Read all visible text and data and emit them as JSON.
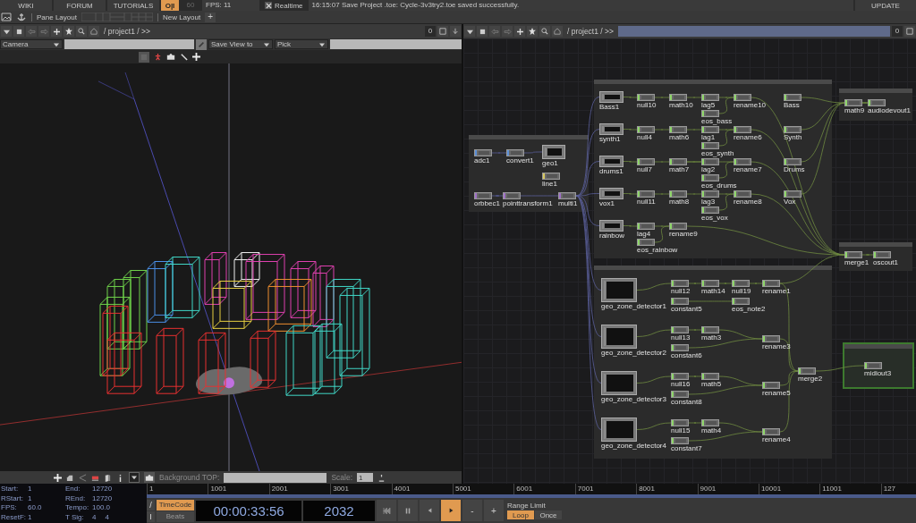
{
  "top_bar": {
    "links": [
      "WIKI",
      "FORUM",
      "TUTORIALS"
    ],
    "perform_toggle": {
      "label": "O|I",
      "on": true
    },
    "fps_limit": "60",
    "fps": "FPS:  11",
    "realtime": {
      "label": "Realtime",
      "checked": true
    },
    "message": "16:15:07 Save Project .toe: Cycle-3v3try2.toe saved successfully.",
    "update": "UPDATE"
  },
  "layout_bar": {
    "pane_layout": "Pane Layout",
    "new_layout": "New Layout",
    "add": "+"
  },
  "viewer_pane": {
    "path": "/ project1 / >>",
    "badge": "0",
    "camera": "Camera",
    "save_view": "Save View to",
    "pick": "Pick",
    "background_label": "Background TOP:",
    "scale_label": "Scale:",
    "scale": "1"
  },
  "network_pane": {
    "path": "/ project1 / >>",
    "badge": "0",
    "groups": [
      {
        "nodes": [
          {
            "name": "adc1",
            "kind": "op",
            "color": "#5b8fd6"
          },
          {
            "name": "convert1",
            "kind": "op",
            "color": "#5b8fd6"
          },
          {
            "name": "geo1",
            "kind": "preview",
            "color": "#8a8a8a"
          },
          {
            "name": "line1",
            "kind": "op",
            "color": "#d8c860"
          },
          {
            "name": "orbbec1",
            "kind": "op",
            "color": "#a070c8"
          },
          {
            "name": "pointtransform1",
            "kind": "op",
            "color": "#a070c8"
          },
          {
            "name": "multi1",
            "kind": "op",
            "color": "#a070c8"
          }
        ]
      },
      {
        "nodes": [
          {
            "name": "Bass1",
            "kind": "preview",
            "color": "#8a8a8a"
          },
          {
            "name": "null10",
            "kind": "op",
            "color": "#8fd66a"
          },
          {
            "name": "math10",
            "kind": "op",
            "color": "#8fd66a"
          },
          {
            "name": "lag5",
            "kind": "op",
            "color": "#8fd66a"
          },
          {
            "name": "rename10",
            "kind": "op",
            "color": "#8fd66a"
          },
          {
            "name": "Bass",
            "kind": "op",
            "color": "#8fd66a"
          },
          {
            "name": "eos_bass",
            "kind": "op",
            "color": "#8fd66a"
          },
          {
            "name": "synth1",
            "kind": "preview",
            "color": "#8a8a8a"
          },
          {
            "name": "null4",
            "kind": "op",
            "color": "#8fd66a"
          },
          {
            "name": "math6",
            "kind": "op",
            "color": "#8fd66a"
          },
          {
            "name": "lag1",
            "kind": "op",
            "color": "#8fd66a"
          },
          {
            "name": "rename6",
            "kind": "op",
            "color": "#8fd66a"
          },
          {
            "name": "eos_synth",
            "kind": "op",
            "color": "#8fd66a"
          },
          {
            "name": "Synth",
            "kind": "op",
            "color": "#8fd66a"
          },
          {
            "name": "drums1",
            "kind": "preview",
            "color": "#8a8a8a"
          },
          {
            "name": "null7",
            "kind": "op",
            "color": "#8fd66a"
          },
          {
            "name": "math7",
            "kind": "op",
            "color": "#8fd66a"
          },
          {
            "name": "lag2",
            "kind": "op",
            "color": "#8fd66a"
          },
          {
            "name": "rename7",
            "kind": "op",
            "color": "#8fd66a"
          },
          {
            "name": "eos_drums",
            "kind": "op",
            "color": "#8fd66a"
          },
          {
            "name": "Drums",
            "kind": "op",
            "color": "#8fd66a"
          },
          {
            "name": "Vox",
            "kind": "op",
            "color": "#8fd66a"
          },
          {
            "name": "vox1",
            "kind": "preview",
            "color": "#8a8a8a"
          },
          {
            "name": "null11",
            "kind": "op",
            "color": "#8fd66a"
          },
          {
            "name": "math8",
            "kind": "op",
            "color": "#8fd66a"
          },
          {
            "name": "lag3",
            "kind": "op",
            "color": "#8fd66a"
          },
          {
            "name": "rename8",
            "kind": "op",
            "color": "#8fd66a"
          },
          {
            "name": "rainbow",
            "kind": "preview",
            "color": "#8a8a8a"
          },
          {
            "name": "lag4",
            "kind": "op",
            "color": "#8fd66a"
          },
          {
            "name": "eos_vox",
            "kind": "op",
            "color": "#8fd66a"
          },
          {
            "name": "rename9",
            "kind": "op",
            "color": "#8fd66a"
          },
          {
            "name": "eos_rainbow",
            "kind": "op",
            "color": "#8fd66a"
          }
        ]
      },
      {
        "nodes": [
          {
            "name": "math9",
            "kind": "op",
            "color": "#8fd66a"
          },
          {
            "name": "audiodevout1",
            "kind": "op",
            "color": "#8fd66a"
          }
        ]
      },
      {
        "nodes": [
          {
            "name": "merge1",
            "kind": "op",
            "color": "#8fd66a"
          },
          {
            "name": "oscout1",
            "kind": "op",
            "color": "#8fd66a"
          }
        ]
      },
      {
        "nodes": [
          {
            "name": "geo_zone_detector1",
            "kind": "preview",
            "color": "#8a8a8a"
          },
          {
            "name": "null12",
            "kind": "op",
            "color": "#8fd66a"
          },
          {
            "name": "math14",
            "kind": "op",
            "color": "#8fd66a"
          },
          {
            "name": "null19",
            "kind": "op",
            "color": "#8fd66a"
          },
          {
            "name": "rename1",
            "kind": "op",
            "color": "#8fd66a"
          },
          {
            "name": "constant5",
            "kind": "op",
            "color": "#8fd66a"
          },
          {
            "name": "eos_note2",
            "kind": "op",
            "color": "#8fd66a"
          },
          {
            "name": "geo_zone_detector2",
            "kind": "preview",
            "color": "#8a8a8a"
          },
          {
            "name": "null13",
            "kind": "op",
            "color": "#8fd66a"
          },
          {
            "name": "math3",
            "kind": "op",
            "color": "#8fd66a"
          },
          {
            "name": "constant6",
            "kind": "op",
            "color": "#8fd66a"
          },
          {
            "name": "rename3",
            "kind": "op",
            "color": "#8fd66a"
          },
          {
            "name": "merge2",
            "kind": "op",
            "color": "#8fd66a"
          },
          {
            "name": "geo_zone_detector3",
            "kind": "preview",
            "color": "#8a8a8a"
          },
          {
            "name": "null16",
            "kind": "op",
            "color": "#8fd66a"
          },
          {
            "name": "math5",
            "kind": "op",
            "color": "#8fd66a"
          },
          {
            "name": "constant8",
            "kind": "op",
            "color": "#8fd66a"
          },
          {
            "name": "rename5",
            "kind": "op",
            "color": "#8fd66a"
          },
          {
            "name": "geo_zone_detector4",
            "kind": "preview",
            "color": "#8a8a8a"
          },
          {
            "name": "null15",
            "kind": "op",
            "color": "#8fd66a"
          },
          {
            "name": "math4",
            "kind": "op",
            "color": "#8fd66a"
          },
          {
            "name": "constant7",
            "kind": "op",
            "color": "#8fd66a"
          },
          {
            "name": "rename4",
            "kind": "op",
            "color": "#8fd66a"
          }
        ]
      },
      {
        "nodes": [
          {
            "name": "midiout3",
            "kind": "op",
            "color": "#8fd66a"
          }
        ]
      }
    ]
  },
  "timeline": {
    "settings": [
      {
        "label": "Start:",
        "values": [
          "1"
        ]
      },
      {
        "label": "End:",
        "values": [
          "12720"
        ]
      },
      {
        "label": "RStart:",
        "values": [
          "1"
        ]
      },
      {
        "label": "REnd:",
        "values": [
          "12720"
        ]
      },
      {
        "label": "FPS:",
        "values": [
          "60.0"
        ]
      },
      {
        "label": "Tempo:",
        "values": [
          "100.0"
        ]
      },
      {
        "label": "ResetF:",
        "values": [
          "1"
        ]
      },
      {
        "label": "T Sig:",
        "values": [
          "4",
          "4"
        ]
      }
    ],
    "ruler": [
      "1",
      "1001",
      "2001",
      "3001",
      "4001",
      "5001",
      "6001",
      "7001",
      "8001",
      "9001",
      "10001",
      "11001",
      "127"
    ],
    "side_buttons": [
      "/",
      "I"
    ],
    "modes": [
      {
        "label": "TimeCode",
        "selected": true
      },
      {
        "label": "Beats",
        "selected": false
      }
    ],
    "timecode": "00:00:33:56",
    "frame": "2032",
    "transport": [
      {
        "kind": "first",
        "selected": false
      },
      {
        "kind": "pause",
        "selected": false
      },
      {
        "kind": "back",
        "selected": false
      },
      {
        "kind": "play",
        "selected": true
      }
    ],
    "steps": [
      "-",
      "+"
    ],
    "range_label": "Range Limit",
    "range": [
      {
        "label": "Loop",
        "selected": true
      },
      {
        "label": "Once",
        "selected": false
      }
    ]
  }
}
